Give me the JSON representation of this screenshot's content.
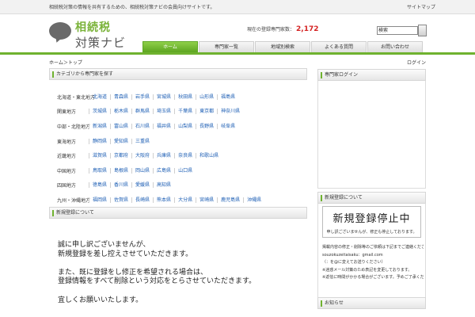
{
  "topbar": {
    "tagline": "相続税対策の情報を共有するための、相続税対策ナビの会員向けサイトです。",
    "link": "サイトマップ"
  },
  "logo": {
    "line1": "相続税",
    "line2": "対策ナビ"
  },
  "counter": {
    "label": "現在の登録専門家数：",
    "value": "2,172"
  },
  "search": {
    "value": "検索"
  },
  "nav": {
    "tabs": [
      {
        "label": "ホーム",
        "active": true
      },
      {
        "label": "専門家一覧",
        "active": false
      },
      {
        "label": "地域別検索",
        "active": false
      },
      {
        "label": "よくある質問",
        "active": false
      },
      {
        "label": "お問い合わせ",
        "active": false
      }
    ]
  },
  "breadcrumb": {
    "left": "ホーム＞トップ",
    "right": "ログイン"
  },
  "categories": {
    "heading": "カテゴリから専門家を探す",
    "rows": [
      {
        "label": "北海道・東北地方",
        "links": [
          "北海道",
          "青森県",
          "岩手県",
          "宮城県",
          "秋田県",
          "山形県",
          "福島県"
        ]
      },
      {
        "label": "関東地方",
        "links": [
          "茨城県",
          "栃木県",
          "群馬県",
          "埼玉県",
          "千葉県",
          "東京都",
          "神奈川県"
        ]
      },
      {
        "label": "中部・北陸地方",
        "links": [
          "新潟県",
          "富山県",
          "石川県",
          "福井県",
          "山梨県",
          "長野県",
          "岐阜県"
        ]
      },
      {
        "label": "東海地方",
        "links": [
          "静岡県",
          "愛知県",
          "三重県"
        ]
      },
      {
        "label": "近畿地方",
        "links": [
          "滋賀県",
          "京都府",
          "大阪府",
          "兵庫県",
          "奈良県",
          "和歌山県"
        ]
      },
      {
        "label": "中国地方",
        "links": [
          "鳥取県",
          "島根県",
          "岡山県",
          "広島県",
          "山口県"
        ]
      },
      {
        "label": "四国地方",
        "links": [
          "徳島県",
          "香川県",
          "愛媛県",
          "高知県"
        ]
      },
      {
        "label": "九州・沖縄地方",
        "links": [
          "福岡県",
          "佐賀県",
          "長崎県",
          "熊本県",
          "大分県",
          "宮崎県",
          "鹿児島県",
          "沖縄県"
        ]
      }
    ]
  },
  "notice_box": {
    "heading": "新規登録について",
    "lines": [
      "誠に申し訳ございませんが、",
      "新規登録を差し控えさせていただきます。",
      "",
      "また、既に登録をし修正を希望される場合は、",
      "登録情報をすべて削除という対応をとらさせていただきます。",
      "",
      "宜しくお願いいたします。"
    ]
  },
  "sidebar": {
    "box1_heading": "専門家ログイン",
    "box2_heading": "新規登録について",
    "stop_big": "新規登録停止中",
    "stop_small": "申し訳ございませんが、修正も停止しております。",
    "text_lines": [
      "掲載内容の修正・削除等のご依頼は下記までご連絡ください。",
      "souzokuzeitaisaku：gmail.com",
      "（：を@に変えてお送りください）",
      "※迷惑メール対策のため表記を変更しております。",
      "※返信に時間がかかる場合がございます。予めご了承ください。"
    ],
    "box3_heading": "お知らせ"
  },
  "colors": {
    "accent_green": "#6fb22f",
    "link_blue": "#1e5fb5",
    "counter_red": "#d42222"
  }
}
